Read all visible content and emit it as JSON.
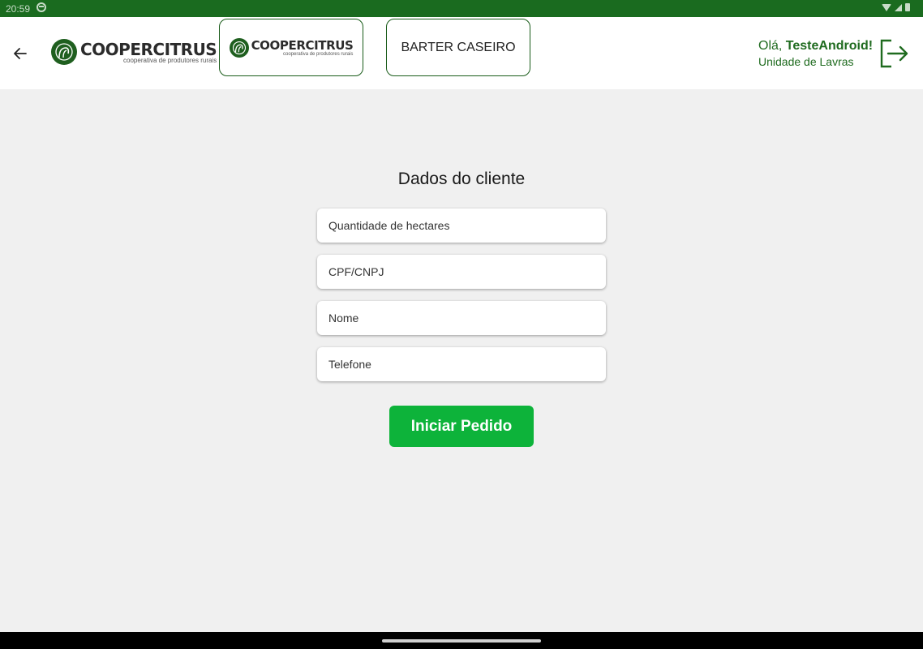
{
  "status_bar": {
    "time": "20:59"
  },
  "header": {
    "brand": {
      "name": "COOPERCITRUS",
      "tagline": "cooperativa de produtores rurais"
    },
    "tabs": [
      {
        "type": "logo",
        "name": "COOPERCITRUS",
        "tagline": "cooperativa de produtores rurais"
      },
      {
        "type": "text",
        "label": "BARTER CASEIRO"
      }
    ],
    "user": {
      "greeting_prefix": "Olá, ",
      "username": "TesteAndroid!",
      "unit": "Unidade de Lavras"
    }
  },
  "form": {
    "title": "Dados do cliente",
    "fields": [
      {
        "placeholder": "Quantidade de hectares",
        "value": ""
      },
      {
        "placeholder": "CPF/CNPJ",
        "value": ""
      },
      {
        "placeholder": "Nome",
        "value": ""
      },
      {
        "placeholder": "Telefone",
        "value": ""
      }
    ],
    "submit_label": "Iniciar Pedido"
  },
  "icons": {
    "back": "arrow-left-icon",
    "logout": "logout-icon",
    "brand_mark": "leaf-logo-icon"
  },
  "colors": {
    "status_bar": "#1a6b1f",
    "accent_green": "#0db33a",
    "brand_green": "#1f6b1f",
    "background": "#f0f0f0"
  }
}
